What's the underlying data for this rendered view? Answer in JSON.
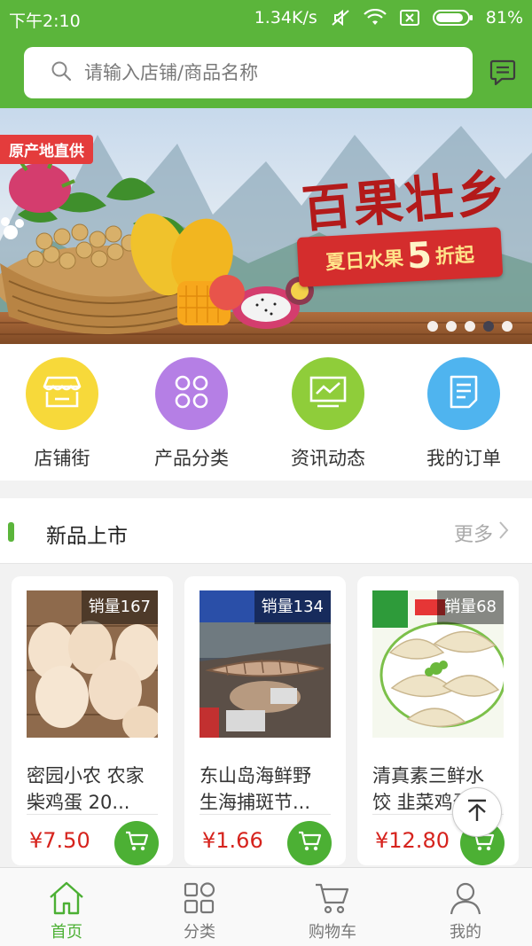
{
  "status_bar": {
    "time": "下午2:10",
    "net_speed": "1.34K/s",
    "battery": "81%"
  },
  "search": {
    "placeholder": "请输入店铺/商品名称"
  },
  "banner": {
    "tag": "原产地直供",
    "title": "百果壮乡",
    "ribbon_text_before": "夏日水果",
    "ribbon_number": "5",
    "ribbon_text_after": "折起",
    "dots": 5,
    "active_dot": 4
  },
  "quicknav": [
    {
      "label": "店铺街",
      "color": "#f7d93a",
      "icon": "store-icon"
    },
    {
      "label": "产品分类",
      "color": "#b57fe5",
      "icon": "category-grid-icon"
    },
    {
      "label": "资讯动态",
      "color": "#8fcd3a",
      "icon": "news-chart-icon"
    },
    {
      "label": "我的订单",
      "color": "#4fb4ef",
      "icon": "order-list-icon"
    }
  ],
  "section": {
    "title": "新品上市",
    "more": "更多"
  },
  "products": [
    {
      "sales": "销量167",
      "name_line1": "密园小农 农家",
      "name_line2": "柴鸡蛋 20...",
      "price": "¥7.50"
    },
    {
      "sales": "销量134",
      "name_line1": "东山岛海鲜野",
      "name_line2": "生海捕斑节...",
      "price": "¥1.66"
    },
    {
      "sales": "销量68",
      "name_line1": "清真素三鲜水",
      "name_line2": "饺 韭菜鸡蛋...",
      "price": "¥12.80"
    }
  ],
  "tabbar": [
    {
      "label": "首页",
      "icon": "home-icon",
      "active": true
    },
    {
      "label": "分类",
      "icon": "category-icon",
      "active": false
    },
    {
      "label": "购物车",
      "icon": "cart-icon",
      "active": false
    },
    {
      "label": "我的",
      "icon": "user-icon",
      "active": false
    }
  ],
  "colors": {
    "brand": "#5bb53b",
    "price": "#d6231d",
    "active_tab": "#4cb034"
  }
}
